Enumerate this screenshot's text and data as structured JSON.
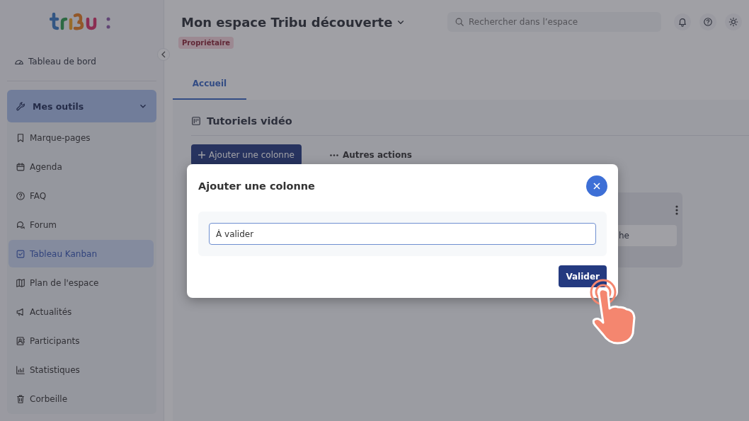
{
  "sidebar": {
    "dashboard": "Tableau de bord",
    "group": {
      "label": "Mes outils",
      "expanded": true
    },
    "items": [
      {
        "label": "Marque-pages",
        "selected": false
      },
      {
        "label": "Agenda",
        "selected": false
      },
      {
        "label": "FAQ",
        "selected": false
      },
      {
        "label": "Forum",
        "selected": false
      },
      {
        "label": "Tableau Kanban",
        "selected": true
      },
      {
        "label": "Plan de l'espace",
        "selected": false
      },
      {
        "label": "Actualités",
        "selected": false
      },
      {
        "label": "Participants",
        "selected": false
      },
      {
        "label": "Statistiques",
        "selected": false
      },
      {
        "label": "Corbeille",
        "selected": false
      }
    ]
  },
  "header": {
    "title": "Mon espace Tribu découverte",
    "badge": "Propriétaire",
    "search": {
      "placeholder": "Rechercher dans l’espace"
    }
  },
  "tabs": [
    {
      "label": "Accueil",
      "selected": true
    }
  ],
  "board": {
    "title": "Tutoriels vidéo",
    "actions": [
      "Ajouter une colonne",
      "Autres actions"
    ],
    "card_text": "he"
  },
  "dialog": {
    "title": "Ajouter une colonne",
    "input": {
      "value": "À valider"
    },
    "submit": "Valider"
  }
}
